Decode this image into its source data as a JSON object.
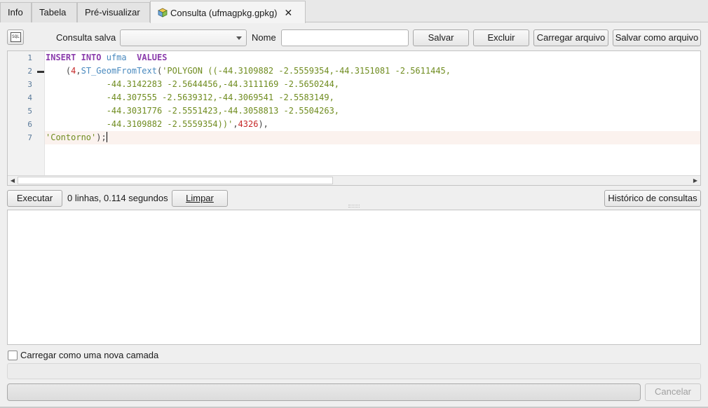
{
  "tabs": [
    {
      "label": "Info"
    },
    {
      "label": "Tabela"
    },
    {
      "label": "Pré-visualizar"
    },
    {
      "label": "Consulta (ufmagpkg.gpkg)",
      "close": "✕"
    }
  ],
  "toolbar": {
    "saved_query_label": "Consulta salva",
    "saved_query_value": "",
    "name_label": "Nome",
    "name_value": "",
    "save_label": "Salvar",
    "delete_label": "Excluir",
    "load_file_label": "Carregar arquivo",
    "save_file_label": "Salvar como arquivo",
    "sql_icon": "SQL"
  },
  "editor": {
    "line_numbers": [
      "1",
      "2",
      "3",
      "4",
      "5",
      "6",
      "7"
    ],
    "lines": [
      [
        {
          "t": "INSERT",
          "c": "kw"
        },
        {
          "t": " ",
          "c": "punc"
        },
        {
          "t": "INTO",
          "c": "kw"
        },
        {
          "t": " ",
          "c": "punc"
        },
        {
          "t": "ufma",
          "c": "ident"
        },
        {
          "t": "  ",
          "c": "punc"
        },
        {
          "t": "VALUES",
          "c": "kw"
        }
      ],
      [
        {
          "t": "    (",
          "c": "punc"
        },
        {
          "t": "4",
          "c": "num"
        },
        {
          "t": ",",
          "c": "punc"
        },
        {
          "t": "ST_GeomFromText",
          "c": "ident"
        },
        {
          "t": "(",
          "c": "punc"
        },
        {
          "t": "'POLYGON ((-44.3109882 -2.5559354,-44.3151081 -2.5611445,",
          "c": "str"
        }
      ],
      [
        {
          "t": "            -44.3142283 -2.5644456,-44.3111169 -2.5650244,",
          "c": "str"
        }
      ],
      [
        {
          "t": "            -44.307555 -2.5639312,-44.3069541 -2.5583149,",
          "c": "str"
        }
      ],
      [
        {
          "t": "            -44.3031776 -2.5551423,-44.3058813 -2.5504263,",
          "c": "str"
        }
      ],
      [
        {
          "t": "            -44.3109882 -2.5559354))'",
          "c": "str"
        },
        {
          "t": ",",
          "c": "punc"
        },
        {
          "t": "4326",
          "c": "num"
        },
        {
          "t": "),",
          "c": "punc"
        }
      ],
      [
        {
          "t": "'Contorno'",
          "c": "str"
        },
        {
          "t": ");",
          "c": "punc"
        }
      ]
    ],
    "current_line": 7
  },
  "actions": {
    "execute_label": "Executar",
    "result_status": "0 linhas, 0.114 segundos",
    "clear_label": "Limpar",
    "history_label": "Histórico de consultas"
  },
  "options": {
    "load_as_layer_label": "Carregar como uma nova camada",
    "load_as_layer_checked": false
  },
  "footer": {
    "cancel_label": "Cancelar"
  }
}
